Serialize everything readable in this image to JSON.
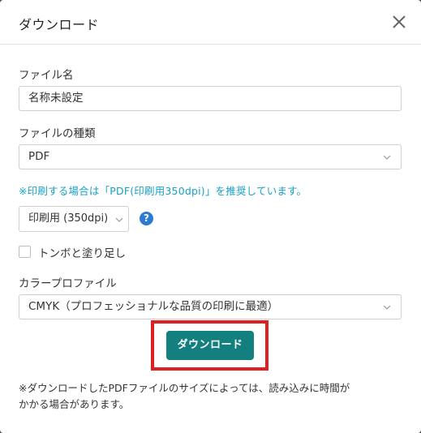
{
  "header": {
    "title": "ダウンロード",
    "close_icon": "close-icon"
  },
  "form": {
    "file_name": {
      "label": "ファイル名",
      "value": "名称未設定"
    },
    "file_type": {
      "label": "ファイルの種類",
      "selected": "PDF"
    },
    "notice": "※印刷する場合は「PDF(印刷用350dpi)」を推奨しています。",
    "resolution": {
      "selected": "印刷用 (350dpi)",
      "help_icon": "question-circle-icon"
    },
    "crop_marks": {
      "label": "トンボと塗り足し",
      "checked": false
    },
    "color_profile": {
      "label": "カラープロファイル",
      "selected": "CMYK（プロフェッショナルな品質の印刷に最適）"
    }
  },
  "actions": {
    "download_label": "ダウンロード"
  },
  "footnote": {
    "line1": "※ダウンロードしたPDFファイルのサイズによっては、読み込みに時間が",
    "line2": "かかる場合があります。"
  },
  "colors": {
    "accent": "#13807f",
    "notice": "#17a0c6",
    "highlight": "#e02020",
    "help": "#2a7bd1"
  }
}
